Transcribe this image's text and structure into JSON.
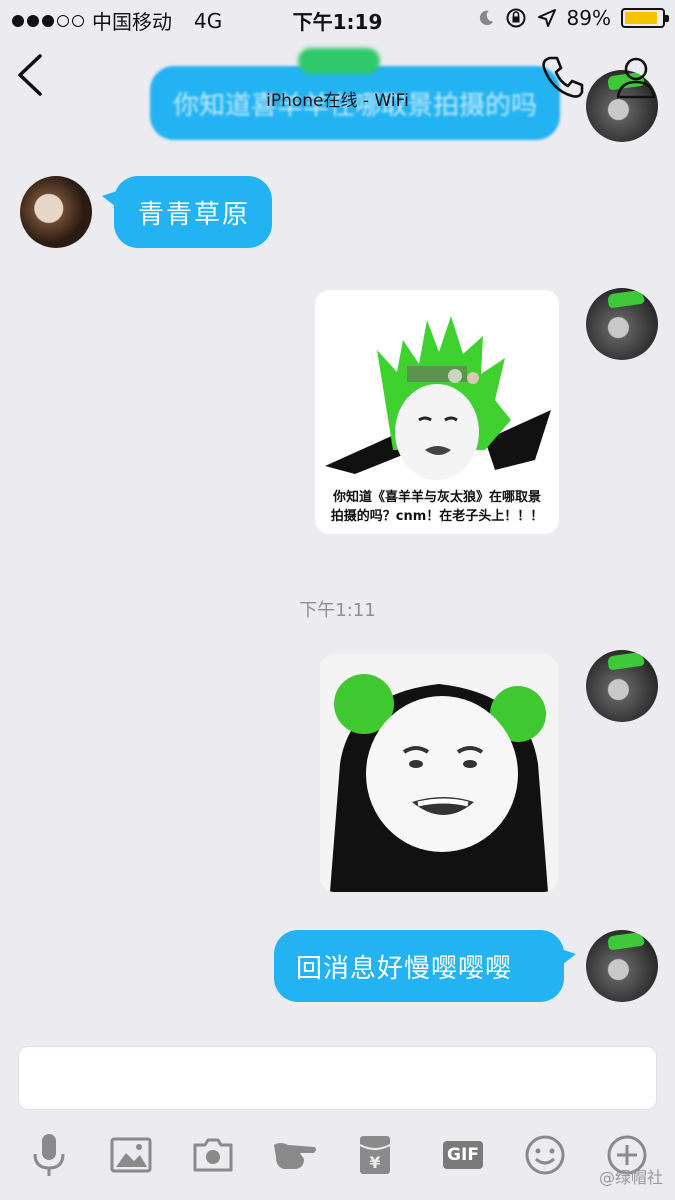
{
  "status_bar": {
    "carrier": "中国移动",
    "network": "4G",
    "time": "下午1:19",
    "battery_percent": "89%",
    "battery_level": 0.89,
    "signal_bars_filled": 3,
    "signal_bars_total": 5
  },
  "nav": {
    "subtitle": "iPhone在线 - WiFi",
    "icons": [
      "back-chevron-icon",
      "phone-icon",
      "profile-icon"
    ]
  },
  "messages": {
    "top_partial": "你知道喜羊羊在哪取景拍摄的吗",
    "received_text": "青青草原",
    "sticker1_caption_line1": "你知道《喜羊羊与灰太狼》在哪取景",
    "sticker1_caption_line2": "拍摄的吗？cnm！在老子头上！！！",
    "timestamp": "下午1:11",
    "sent_text": "回消息好慢嘤嘤嘤"
  },
  "toolbar": {
    "icons": [
      "microphone-icon",
      "image-icon",
      "camera-icon",
      "hand-icon",
      "red-envelope-icon",
      "gif-icon",
      "emoji-icon",
      "plus-icon"
    ],
    "red_envelope_symbol": "¥",
    "gif_label": "GIF"
  },
  "watermark": "@绿帽社",
  "colors": {
    "bubble": "#23b3f2",
    "background": "#ebebf0",
    "hat_green": "#3ec83a"
  }
}
